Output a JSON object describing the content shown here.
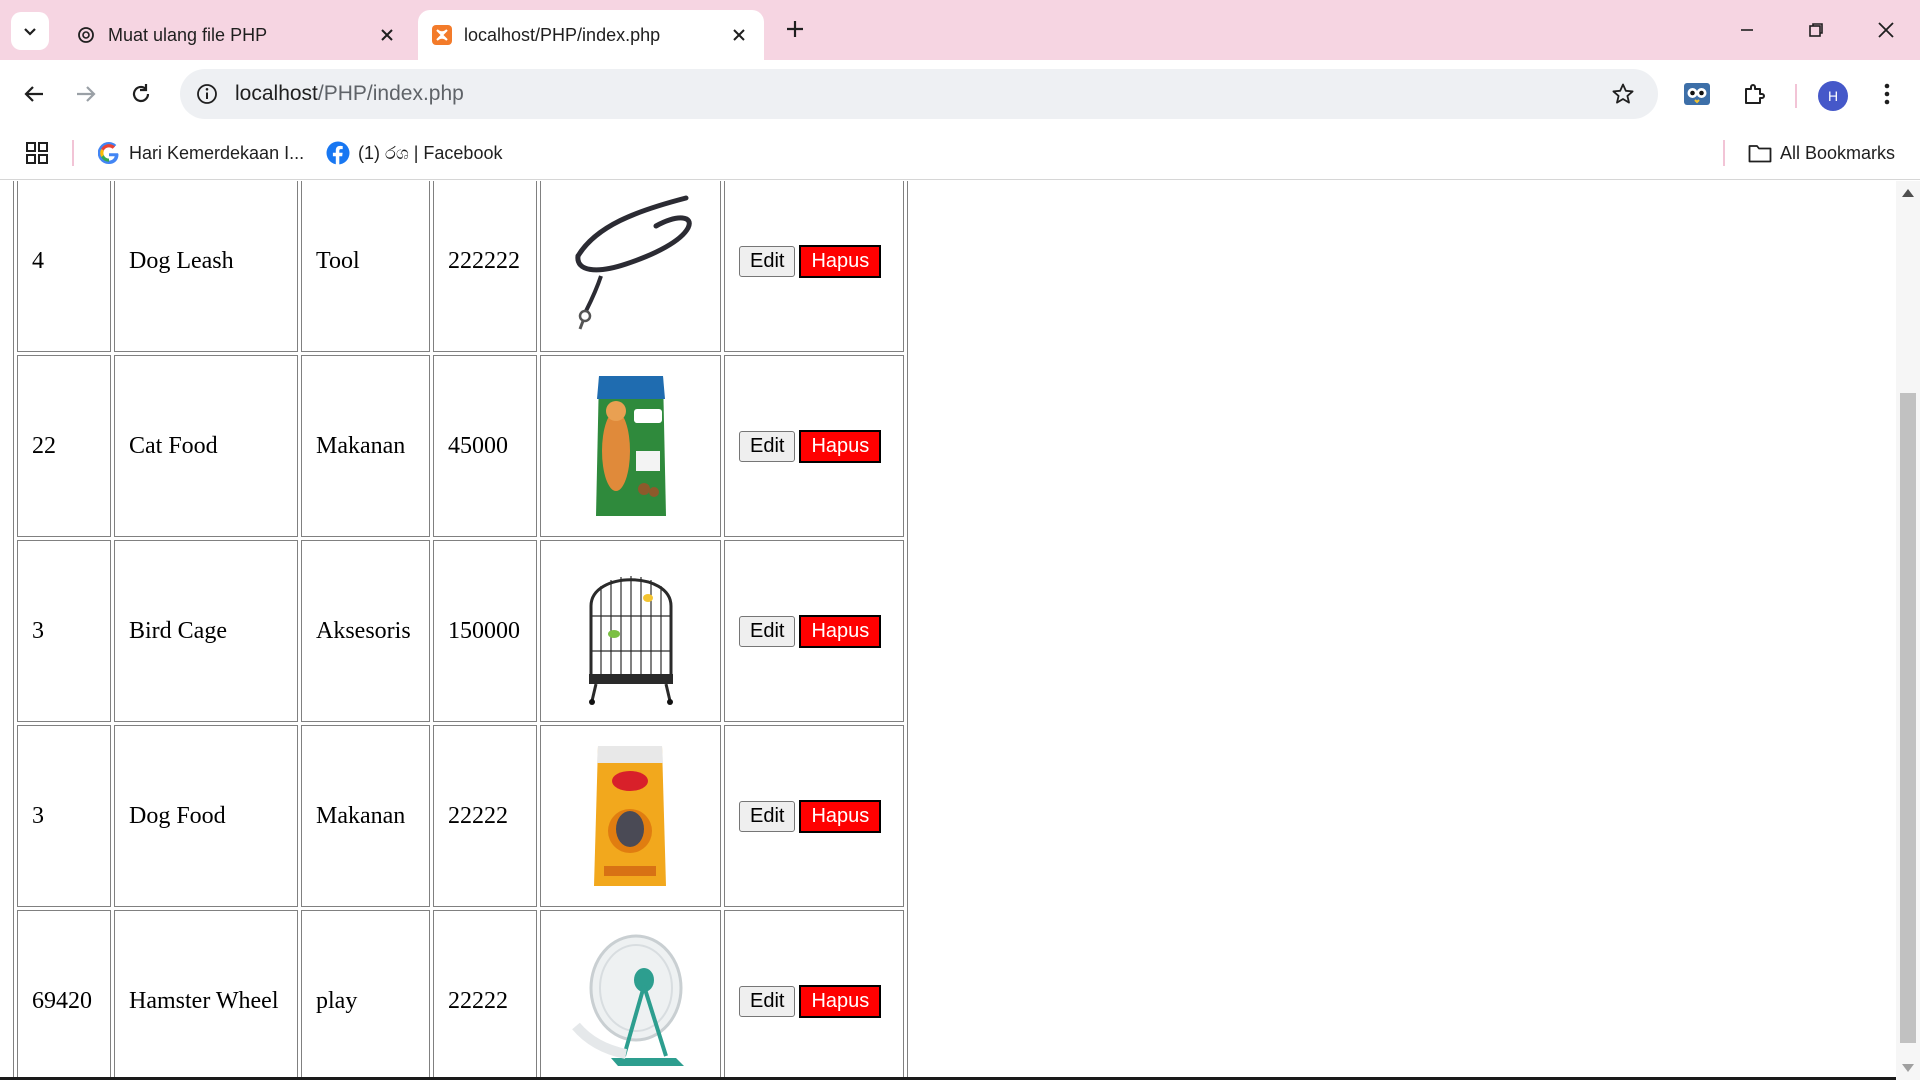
{
  "browser": {
    "tabs": [
      {
        "title": "Muat ulang file PHP",
        "active": false,
        "favicon": "chatgpt-icon"
      },
      {
        "title": "localhost/PHP/index.php",
        "active": true,
        "favicon": "xampp-icon"
      }
    ],
    "address": {
      "host": "localhost",
      "path": "/PHP/index.php"
    },
    "profile_initial": "H",
    "bookmarks": [
      {
        "label": "Hari Kemerdekaan I...",
        "icon": "google-icon"
      },
      {
        "label": "(1) රශ | Facebook",
        "icon": "facebook-icon"
      }
    ],
    "all_bookmarks_label": "All Bookmarks"
  },
  "products": {
    "rows": [
      {
        "id": "4",
        "name": "Dog Leash",
        "category": "Tool",
        "price": "222222",
        "image": "dog-leash-image"
      },
      {
        "id": "22",
        "name": "Cat Food",
        "category": "Makanan",
        "price": "45000",
        "image": "cat-food-bag-image"
      },
      {
        "id": "3",
        "name": "Bird Cage",
        "category": "Aksesoris",
        "price": "150000",
        "image": "bird-cage-image"
      },
      {
        "id": "3",
        "name": "Dog Food",
        "category": "Makanan",
        "price": "22222",
        "image": "dog-food-bag-image"
      },
      {
        "id": "69420",
        "name": "Hamster Wheel",
        "category": "play",
        "price": "22222",
        "image": "hamster-wheel-image"
      }
    ],
    "edit_label": "Edit",
    "delete_label": "Hapus",
    "colors": {
      "delete_bg": "#ff0000",
      "tabbar_bg": "#f6d5e2"
    }
  }
}
